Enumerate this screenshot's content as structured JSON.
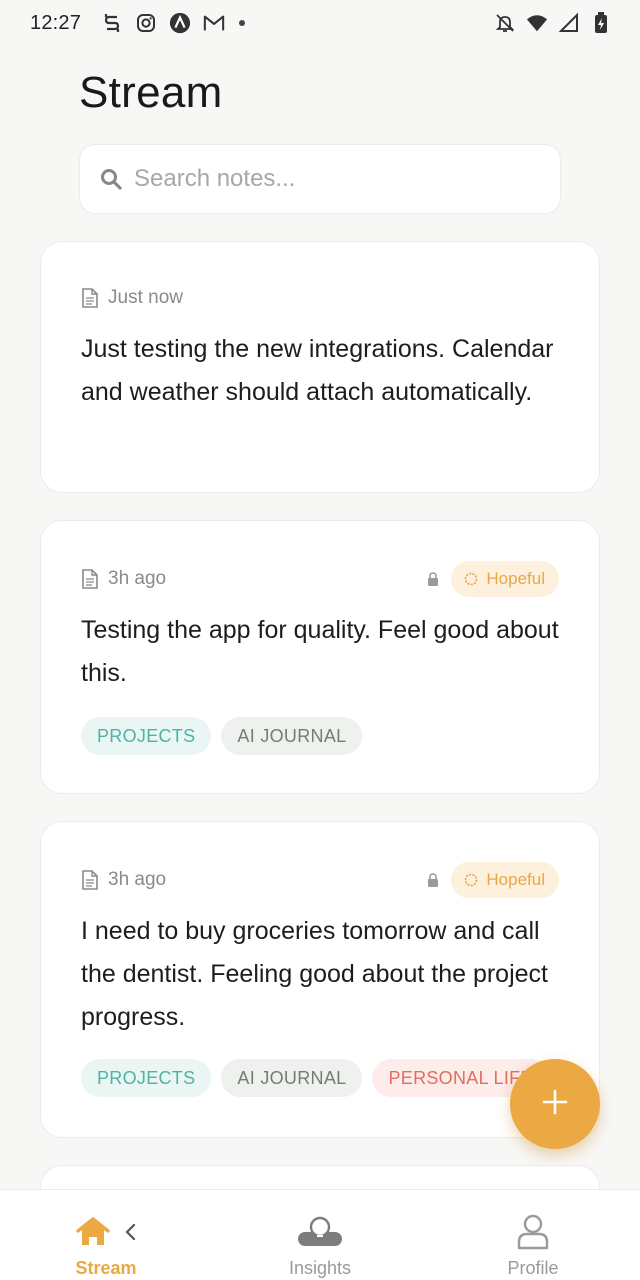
{
  "status_bar": {
    "time": "12:27",
    "left_icons": [
      "s-app-icon",
      "instagram-icon",
      "arc-app-icon",
      "gmail-icon",
      "notification-dot"
    ],
    "right_icons": [
      "do-not-disturb-icon",
      "wifi-icon",
      "signal-icon",
      "battery-charging-icon"
    ]
  },
  "page": {
    "title": "Stream"
  },
  "search": {
    "placeholder": "Search notes..."
  },
  "notes": [
    {
      "time": "Just now",
      "text": "Just testing the new integrations. Calendar and weather should attach automatically.",
      "mood": null,
      "tags": []
    },
    {
      "time": "3h ago",
      "text": "Testing the app for quality. Feel good about this.",
      "mood": "Hopeful",
      "tags": [
        "PROJECTS",
        "AI JOURNAL"
      ]
    },
    {
      "time": "3h ago",
      "text": "I need to buy groceries tomorrow and call the dentist. Feeling good about the project progress.",
      "mood": "Hopeful",
      "tags": [
        "PROJECTS",
        "AI JOURNAL",
        "PERSONAL LIFE"
      ]
    }
  ],
  "fab": {
    "icon": "plus-icon"
  },
  "nav": {
    "items": [
      {
        "label": "Stream",
        "icon": "home-icon",
        "active": true
      },
      {
        "label": "Insights",
        "icon": "lightbulb-icon",
        "active": false
      },
      {
        "label": "Profile",
        "icon": "person-icon",
        "active": false
      }
    ]
  },
  "colors": {
    "accent": "#eca842",
    "background": "#f7f7f5",
    "mood_badge_bg": "#fdf0dc",
    "tag_projects": "#4fb3a4",
    "tag_journal": "#6f7f74",
    "tag_personal": "#e06f60"
  }
}
